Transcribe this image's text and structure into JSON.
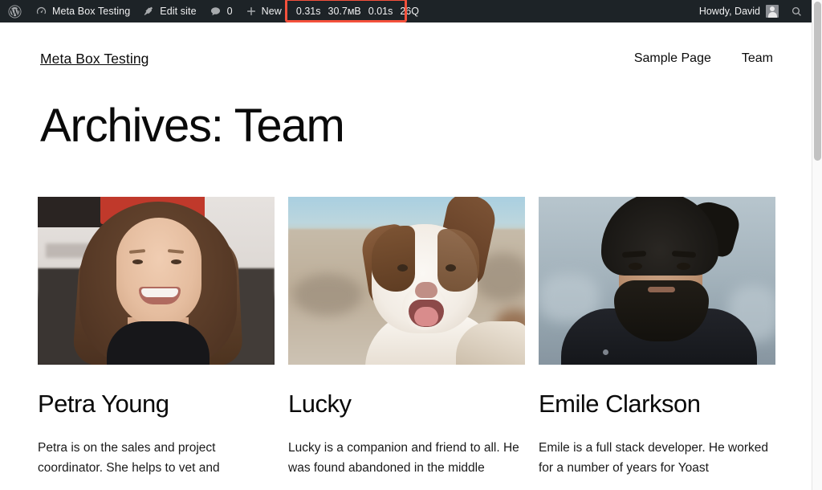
{
  "adminbar": {
    "wp_logo": "wordpress-logo",
    "site_name": "Meta Box Testing",
    "edit_site": "Edit site",
    "comments_count": "0",
    "new_label": "New",
    "perf": {
      "load_time": "0.31s",
      "memory": "30.7мB",
      "query_time": "0.01s",
      "queries": "26Q",
      "highlight_color": "#f4513c"
    },
    "howdy": "Howdy, David",
    "search": "search-icon",
    "background_color": "#1d2327"
  },
  "site": {
    "title": "Meta Box Testing",
    "nav": [
      {
        "label": "Sample Page"
      },
      {
        "label": "Team"
      }
    ],
    "archive_title": "Archives: Team",
    "members": [
      {
        "name": "Petra Young",
        "bio": "Petra is on the sales and project coordinator. She helps to vet and",
        "photo_alt": "smiling-woman-portrait"
      },
      {
        "name": "Lucky",
        "bio": "Lucky is a companion and friend to all. He was found abandoned in the middle",
        "photo_alt": "brown-white-dog-portrait"
      },
      {
        "name": "Emile Clarkson",
        "bio": "Emile is a full stack developer. He worked for a number of years for Yoast",
        "photo_alt": "bearded-man-portrait"
      }
    ]
  }
}
